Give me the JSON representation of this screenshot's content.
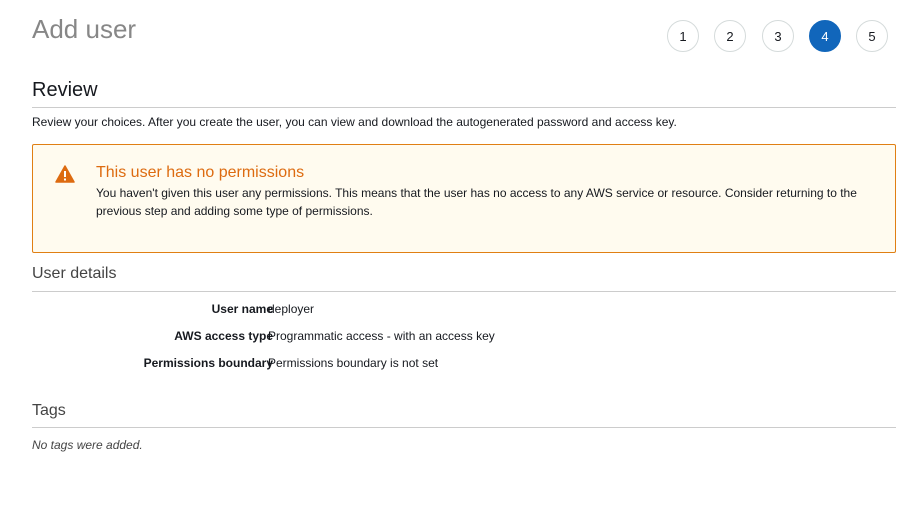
{
  "header": {
    "title": "Add user",
    "steps": [
      {
        "label": "1",
        "active": false
      },
      {
        "label": "2",
        "active": false
      },
      {
        "label": "3",
        "active": false
      },
      {
        "label": "4",
        "active": true
      },
      {
        "label": "5",
        "active": false
      }
    ]
  },
  "review": {
    "heading": "Review",
    "description": "Review your choices. After you create the user, you can view and download the autogenerated password and access key."
  },
  "warning": {
    "icon": "warning-triangle-icon",
    "title": "This user has no permissions",
    "text": "You haven't given this user any permissions. This means that the user has no access to any AWS service or resource. Consider returning to the previous step and adding some type of permissions."
  },
  "user_details": {
    "heading": "User details",
    "rows": [
      {
        "label": "User name",
        "value": "deployer"
      },
      {
        "label": "AWS access type",
        "value": "Programmatic access - with an access key"
      },
      {
        "label": "Permissions boundary",
        "value": "Permissions boundary is not set"
      }
    ]
  },
  "tags": {
    "heading": "Tags",
    "empty_text": "No tags were added."
  },
  "colors": {
    "accent": "#1166bb",
    "warning": "#dd6b10",
    "warning_bg": "#fffbef"
  }
}
